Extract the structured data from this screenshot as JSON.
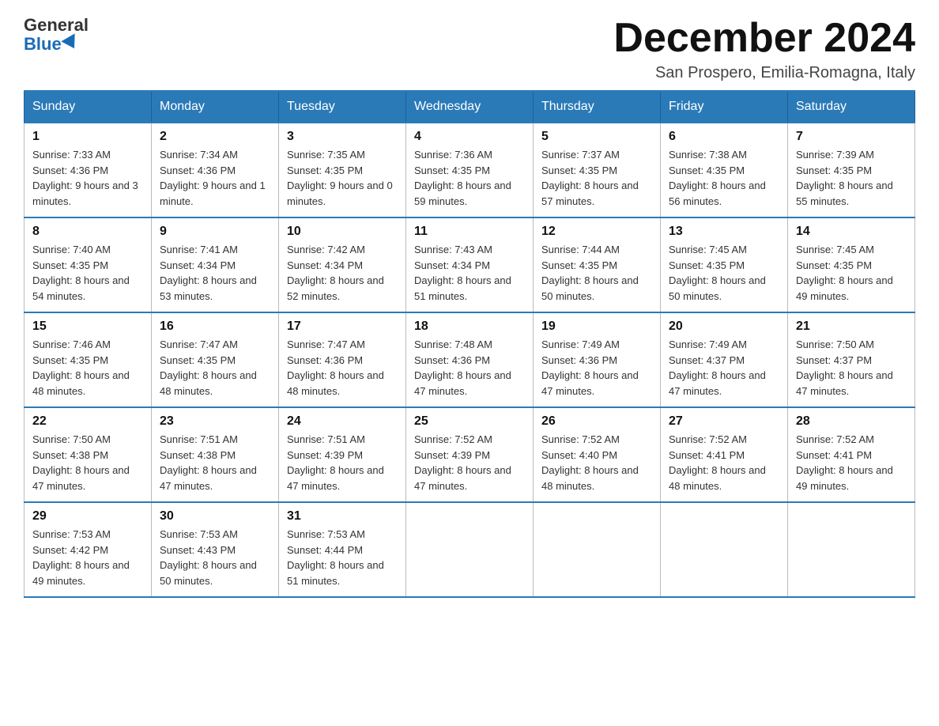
{
  "header": {
    "logo_line1": "General",
    "logo_line2": "Blue",
    "month_title": "December 2024",
    "location": "San Prospero, Emilia-Romagna, Italy"
  },
  "weekdays": [
    "Sunday",
    "Monday",
    "Tuesday",
    "Wednesday",
    "Thursday",
    "Friday",
    "Saturday"
  ],
  "weeks": [
    [
      {
        "day": "1",
        "sunrise": "7:33 AM",
        "sunset": "4:36 PM",
        "daylight": "9 hours and 3 minutes."
      },
      {
        "day": "2",
        "sunrise": "7:34 AM",
        "sunset": "4:36 PM",
        "daylight": "9 hours and 1 minute."
      },
      {
        "day": "3",
        "sunrise": "7:35 AM",
        "sunset": "4:35 PM",
        "daylight": "9 hours and 0 minutes."
      },
      {
        "day": "4",
        "sunrise": "7:36 AM",
        "sunset": "4:35 PM",
        "daylight": "8 hours and 59 minutes."
      },
      {
        "day": "5",
        "sunrise": "7:37 AM",
        "sunset": "4:35 PM",
        "daylight": "8 hours and 57 minutes."
      },
      {
        "day": "6",
        "sunrise": "7:38 AM",
        "sunset": "4:35 PM",
        "daylight": "8 hours and 56 minutes."
      },
      {
        "day": "7",
        "sunrise": "7:39 AM",
        "sunset": "4:35 PM",
        "daylight": "8 hours and 55 minutes."
      }
    ],
    [
      {
        "day": "8",
        "sunrise": "7:40 AM",
        "sunset": "4:35 PM",
        "daylight": "8 hours and 54 minutes."
      },
      {
        "day": "9",
        "sunrise": "7:41 AM",
        "sunset": "4:34 PM",
        "daylight": "8 hours and 53 minutes."
      },
      {
        "day": "10",
        "sunrise": "7:42 AM",
        "sunset": "4:34 PM",
        "daylight": "8 hours and 52 minutes."
      },
      {
        "day": "11",
        "sunrise": "7:43 AM",
        "sunset": "4:34 PM",
        "daylight": "8 hours and 51 minutes."
      },
      {
        "day": "12",
        "sunrise": "7:44 AM",
        "sunset": "4:35 PM",
        "daylight": "8 hours and 50 minutes."
      },
      {
        "day": "13",
        "sunrise": "7:45 AM",
        "sunset": "4:35 PM",
        "daylight": "8 hours and 50 minutes."
      },
      {
        "day": "14",
        "sunrise": "7:45 AM",
        "sunset": "4:35 PM",
        "daylight": "8 hours and 49 minutes."
      }
    ],
    [
      {
        "day": "15",
        "sunrise": "7:46 AM",
        "sunset": "4:35 PM",
        "daylight": "8 hours and 48 minutes."
      },
      {
        "day": "16",
        "sunrise": "7:47 AM",
        "sunset": "4:35 PM",
        "daylight": "8 hours and 48 minutes."
      },
      {
        "day": "17",
        "sunrise": "7:47 AM",
        "sunset": "4:36 PM",
        "daylight": "8 hours and 48 minutes."
      },
      {
        "day": "18",
        "sunrise": "7:48 AM",
        "sunset": "4:36 PM",
        "daylight": "8 hours and 47 minutes."
      },
      {
        "day": "19",
        "sunrise": "7:49 AM",
        "sunset": "4:36 PM",
        "daylight": "8 hours and 47 minutes."
      },
      {
        "day": "20",
        "sunrise": "7:49 AM",
        "sunset": "4:37 PM",
        "daylight": "8 hours and 47 minutes."
      },
      {
        "day": "21",
        "sunrise": "7:50 AM",
        "sunset": "4:37 PM",
        "daylight": "8 hours and 47 minutes."
      }
    ],
    [
      {
        "day": "22",
        "sunrise": "7:50 AM",
        "sunset": "4:38 PM",
        "daylight": "8 hours and 47 minutes."
      },
      {
        "day": "23",
        "sunrise": "7:51 AM",
        "sunset": "4:38 PM",
        "daylight": "8 hours and 47 minutes."
      },
      {
        "day": "24",
        "sunrise": "7:51 AM",
        "sunset": "4:39 PM",
        "daylight": "8 hours and 47 minutes."
      },
      {
        "day": "25",
        "sunrise": "7:52 AM",
        "sunset": "4:39 PM",
        "daylight": "8 hours and 47 minutes."
      },
      {
        "day": "26",
        "sunrise": "7:52 AM",
        "sunset": "4:40 PM",
        "daylight": "8 hours and 48 minutes."
      },
      {
        "day": "27",
        "sunrise": "7:52 AM",
        "sunset": "4:41 PM",
        "daylight": "8 hours and 48 minutes."
      },
      {
        "day": "28",
        "sunrise": "7:52 AM",
        "sunset": "4:41 PM",
        "daylight": "8 hours and 49 minutes."
      }
    ],
    [
      {
        "day": "29",
        "sunrise": "7:53 AM",
        "sunset": "4:42 PM",
        "daylight": "8 hours and 49 minutes."
      },
      {
        "day": "30",
        "sunrise": "7:53 AM",
        "sunset": "4:43 PM",
        "daylight": "8 hours and 50 minutes."
      },
      {
        "day": "31",
        "sunrise": "7:53 AM",
        "sunset": "4:44 PM",
        "daylight": "8 hours and 51 minutes."
      },
      null,
      null,
      null,
      null
    ]
  ]
}
